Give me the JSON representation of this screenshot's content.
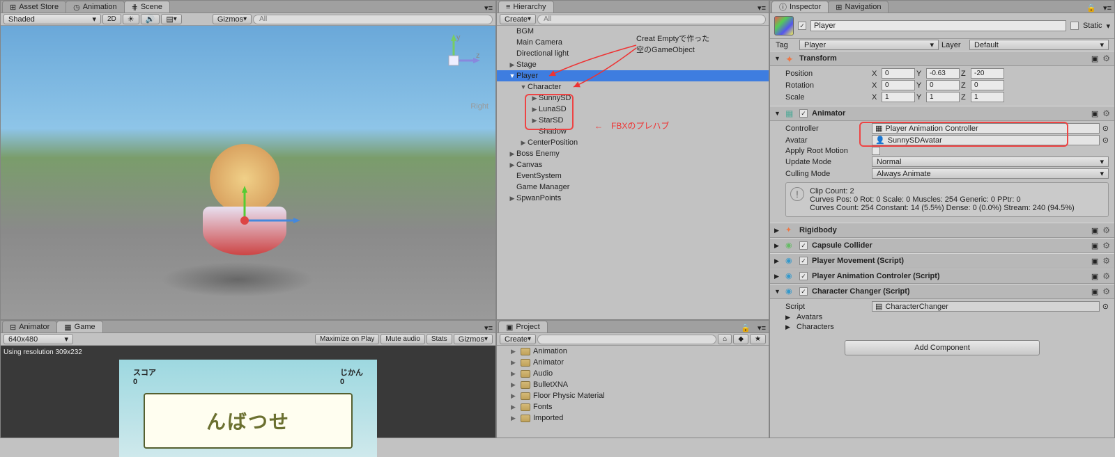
{
  "scene": {
    "tabs": [
      "Asset Store",
      "Animation",
      "Scene"
    ],
    "active_tab": 2,
    "shading": "Shaded",
    "mode2d": "2D",
    "gizmos": "Gizmos",
    "search_placeholder": "All",
    "right_label": "Right"
  },
  "game": {
    "tabs": [
      "Animator",
      "Game"
    ],
    "active_tab": 1,
    "resolution": "640x480",
    "maximize": "Maximize on Play",
    "mute": "Mute audio",
    "stats": "Stats",
    "gizmos": "Gizmos",
    "status": "Using resolution 309x232",
    "hud_left": "スコア",
    "hud_right": "じかん",
    "hud_lval": "0",
    "hud_rval": "0",
    "title_text": "んばつせ"
  },
  "hierarchy": {
    "title": "Hierarchy",
    "create": "Create",
    "search_placeholder": "All",
    "items": [
      {
        "name": "BGM",
        "depth": 0,
        "arrow": "",
        "prefab": false
      },
      {
        "name": "Main Camera",
        "depth": 0,
        "arrow": "",
        "prefab": false
      },
      {
        "name": "Directional light",
        "depth": 0,
        "arrow": "",
        "prefab": false
      },
      {
        "name": "Stage",
        "depth": 0,
        "arrow": "▶",
        "prefab": false
      },
      {
        "name": "Player",
        "depth": 0,
        "arrow": "▼",
        "prefab": false,
        "sel": true
      },
      {
        "name": "Character",
        "depth": 1,
        "arrow": "▼",
        "prefab": false
      },
      {
        "name": "SunnySD",
        "depth": 2,
        "arrow": "▶",
        "prefab": true
      },
      {
        "name": "LunaSD",
        "depth": 2,
        "arrow": "▶",
        "prefab": true
      },
      {
        "name": "StarSD",
        "depth": 2,
        "arrow": "▶",
        "prefab": true
      },
      {
        "name": "Shadow",
        "depth": 2,
        "arrow": "",
        "prefab": false
      },
      {
        "name": "CenterPosition",
        "depth": 1,
        "arrow": "▶",
        "prefab": false
      },
      {
        "name": "Boss Enemy",
        "depth": 0,
        "arrow": "▶",
        "prefab": false
      },
      {
        "name": "Canvas",
        "depth": 0,
        "arrow": "▶",
        "prefab": false
      },
      {
        "name": "EventSystem",
        "depth": 0,
        "arrow": "",
        "prefab": false
      },
      {
        "name": "Game Manager",
        "depth": 0,
        "arrow": "",
        "prefab": false
      },
      {
        "name": "SpwanPoints",
        "depth": 0,
        "arrow": "▶",
        "prefab": false
      }
    ],
    "annot1_l1": "Creat Emptyで作った",
    "annot1_l2": "空のGameObject",
    "annot2": "←　FBXのプレハブ"
  },
  "project": {
    "title": "Project",
    "create": "Create",
    "items": [
      "Animation",
      "Animator",
      "Audio",
      "BulletXNA",
      "Floor Physic Material",
      "Fonts",
      "Imported"
    ]
  },
  "inspector": {
    "tabs": [
      "Inspector",
      "Navigation"
    ],
    "name": "Player",
    "static": "Static",
    "tag_label": "Tag",
    "tag_value": "Player",
    "layer_label": "Layer",
    "layer_value": "Default",
    "transform": {
      "title": "Transform",
      "position": "Position",
      "px": "0",
      "py": "-0.63",
      "pz": "-20",
      "rotation": "Rotation",
      "rx": "0",
      "ry": "0",
      "rz": "0",
      "scale": "Scale",
      "sx": "1",
      "sy": "1",
      "sz": "1"
    },
    "animator": {
      "title": "Animator",
      "controller_label": "Controller",
      "controller_value": "Player Animation Controller",
      "avatar_label": "Avatar",
      "avatar_value": "SunnySDAvatar",
      "apply_root": "Apply Root Motion",
      "update_mode": "Update Mode",
      "update_value": "Normal",
      "culling_mode": "Culling Mode",
      "culling_value": "Always Animate",
      "info_l1": "Clip Count: 2",
      "info_l2": "Curves Pos: 0 Rot: 0 Scale: 0 Muscles: 254 Generic: 0 PPtr: 0",
      "info_l3": "Curves Count: 254 Constant: 14 (5.5%) Dense: 0 (0.0%) Stream: 240 (94.5%)"
    },
    "components": [
      {
        "title": "Rigidbody",
        "icon": "rigidbody"
      },
      {
        "title": "Capsule Collider",
        "icon": "collider",
        "check": true
      },
      {
        "title": "Player Movement (Script)",
        "icon": "script",
        "check": true
      },
      {
        "title": "Player Animation Controler (Script)",
        "icon": "script",
        "check": true
      }
    ],
    "charchanger": {
      "title": "Character Changer (Script)",
      "script_label": "Script",
      "script_value": "CharacterChanger",
      "avatars": "Avatars",
      "characters": "Characters"
    },
    "add_component": "Add Component"
  }
}
